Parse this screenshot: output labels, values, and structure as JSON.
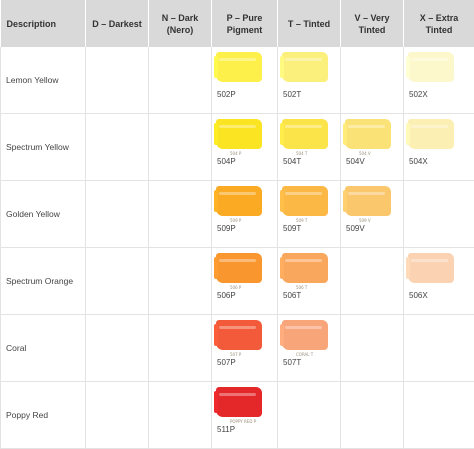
{
  "table": {
    "headers": [
      "Description",
      "D – Darkest",
      "N – Dark (Nero)",
      "P – Pure Pigment",
      "T – Tinted",
      "V – Very Tinted",
      "X – Extra Tinted"
    ],
    "rows": [
      {
        "description": "Lemon Yellow",
        "cells": [
          null,
          null,
          {
            "code": "502P",
            "color": "#fdf04a",
            "note": ""
          },
          {
            "code": "502T",
            "color": "#fbf07c",
            "note": ""
          },
          null,
          {
            "code": "502X",
            "color": "#fcf8cc",
            "note": ""
          }
        ]
      },
      {
        "description": "Spectrum Yellow",
        "cells": [
          null,
          null,
          {
            "code": "504P",
            "color": "#fbe422",
            "note": "504 P"
          },
          {
            "code": "504T",
            "color": "#fbe449",
            "note": "504 T"
          },
          {
            "code": "504V",
            "color": "#fbe276",
            "note": "504 V"
          },
          {
            "code": "504X",
            "color": "#fcefb3",
            "note": ""
          }
        ]
      },
      {
        "description": "Golden Yellow",
        "cells": [
          null,
          null,
          {
            "code": "509P",
            "color": "#fbab23",
            "note": "509 P"
          },
          {
            "code": "509T",
            "color": "#fbb845",
            "note": "509 T"
          },
          {
            "code": "509V",
            "color": "#fbc76c",
            "note": "509 V"
          },
          null
        ]
      },
      {
        "description": "Spectrum Orange",
        "cells": [
          null,
          null,
          {
            "code": "506P",
            "color": "#f9962e",
            "note": "506 P"
          },
          {
            "code": "506T",
            "color": "#f9a75c",
            "note": "506 T"
          },
          null,
          {
            "code": "506X",
            "color": "#fbd3b3",
            "note": ""
          }
        ]
      },
      {
        "description": "Coral",
        "cells": [
          null,
          null,
          {
            "code": "507P",
            "color": "#f25a3a",
            "note": "507 P"
          },
          {
            "code": "507T",
            "color": "#f9a57a",
            "note": "CORAL T"
          },
          null,
          null
        ]
      },
      {
        "description": "Poppy Red",
        "cells": [
          null,
          null,
          {
            "code": "511P",
            "color": "#e42729",
            "note": "POPPY RED P"
          },
          null,
          null,
          null
        ]
      }
    ]
  }
}
